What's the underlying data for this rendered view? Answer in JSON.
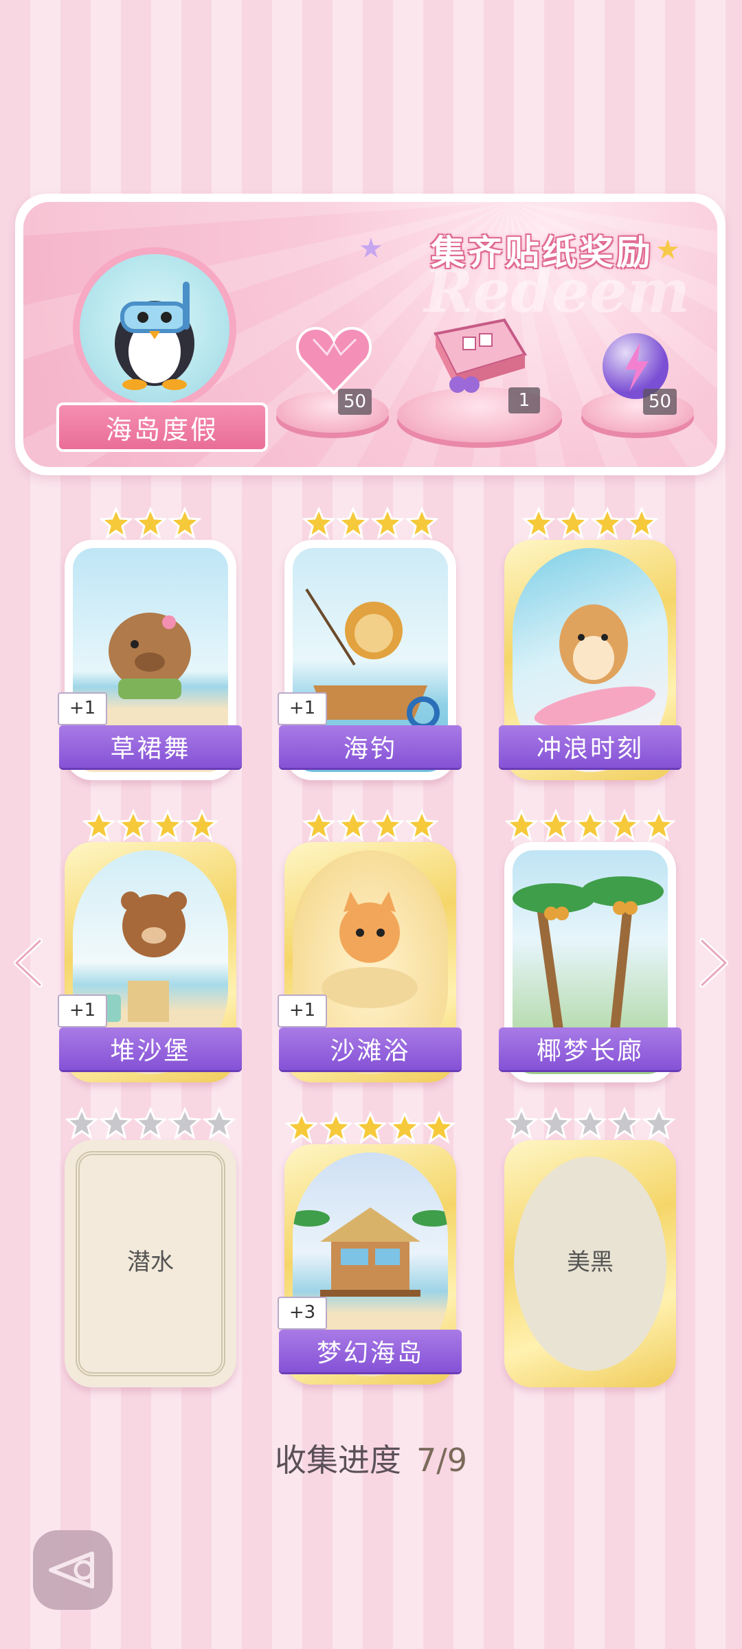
{
  "banner": {
    "title": "集齐贴纸奖励",
    "watermark": "Redeem",
    "theme_name": "海岛度假",
    "rewards": [
      {
        "icon": "pink-heart-gem-icon",
        "count": "50"
      },
      {
        "icon": "gift-box-icon",
        "count": "1"
      },
      {
        "icon": "purple-energy-orb-icon",
        "count": "50"
      }
    ]
  },
  "stickers": [
    {
      "name": "草裙舞",
      "stars": 3,
      "bonus": "+1",
      "frame": "white",
      "art": "capybara-hula-art"
    },
    {
      "name": "海钓",
      "stars": 4,
      "bonus": "+1",
      "frame": "white",
      "art": "lion-fishing-boat-art"
    },
    {
      "name": "冲浪时刻",
      "stars": 4,
      "bonus": "",
      "frame": "gold",
      "art": "hamster-surfing-art"
    },
    {
      "name": "堆沙堡",
      "stars": 4,
      "bonus": "+1",
      "frame": "gold",
      "art": "bear-sandcastle-art"
    },
    {
      "name": "沙滩浴",
      "stars": 4,
      "bonus": "+1",
      "frame": "gold",
      "art": "cat-sand-bath-art"
    },
    {
      "name": "椰梦长廊",
      "stars": 5,
      "bonus": "",
      "frame": "white",
      "art": "coconut-palms-art"
    },
    {
      "name": "潜水",
      "stars": 5,
      "bonus": "",
      "frame": "locked",
      "art": ""
    },
    {
      "name": "梦幻海岛",
      "stars": 5,
      "bonus": "+3",
      "frame": "gold",
      "art": "beach-hut-art"
    },
    {
      "name": "美黑",
      "stars": 5,
      "bonus": "",
      "frame": "locked-gold",
      "art": ""
    }
  ],
  "progress": {
    "label": "收集进度",
    "value": "7/9"
  },
  "colors": {
    "label_purple": "#8552d6",
    "banner_pink": "#f4b2c8",
    "star_gold": "#f6c93b",
    "star_locked": "#c8c8cc"
  }
}
